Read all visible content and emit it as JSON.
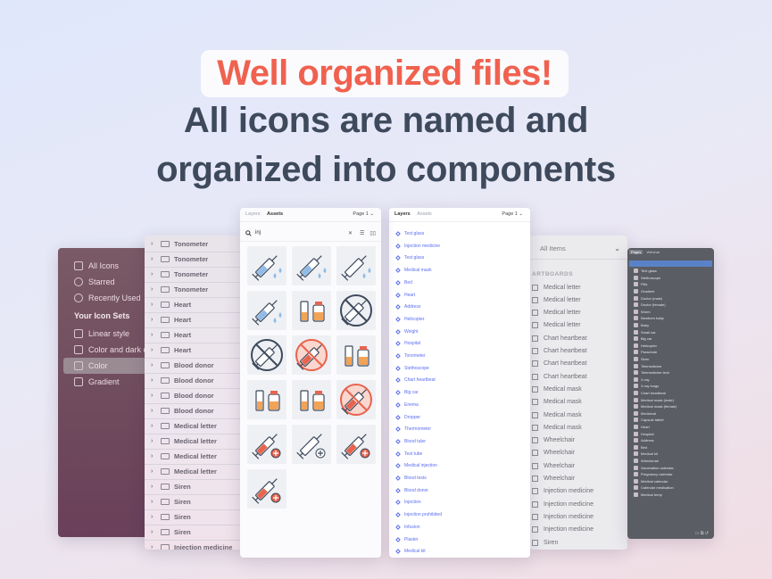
{
  "headline": {
    "title": "Well organized files!",
    "line1": "All icons are named and",
    "line2": "organized into components"
  },
  "colors": {
    "accent": "#f0614f",
    "headline_text": "#3e4a5c",
    "link_blue": "#5b6df0"
  },
  "sidebar": {
    "items": [
      "All Icons",
      "Starred",
      "Recently Used"
    ],
    "section_title": "Your Icon Sets",
    "sets": [
      "Linear style",
      "Color and dark o",
      "Color",
      "Gradient"
    ],
    "selected": "Color"
  },
  "layer_list_b": {
    "rows": [
      "Tonometer",
      "Tonometer",
      "Tonometer",
      "Tonometer",
      "Heart",
      "Heart",
      "Heart",
      "Heart",
      "Blood donor",
      "Blood donor",
      "Blood donor",
      "Blood donor",
      "Medical letter",
      "Medical letter",
      "Medical letter",
      "Medical letter",
      "Siren",
      "Siren",
      "Siren",
      "Siren",
      "Injection medicine"
    ]
  },
  "assets_panel": {
    "tab_layers": "Layers",
    "tab_assets": "Assets",
    "page": "Page 1",
    "search_value": "inj"
  },
  "layers_panel_d": {
    "tab_layers": "Layers",
    "tab_assets": "Assets",
    "page": "Page 1",
    "rows": [
      "Test glass",
      "Injection medicine",
      "Test glass",
      "Medical mask",
      "Bed",
      "Heart",
      "Address",
      "Helicopter",
      "Weight",
      "Hospital",
      "Tonometer",
      "Stethoscope",
      "Chart heartbeat",
      "Big car",
      "Enema",
      "Dropper",
      "Thermometer",
      "Blood tube",
      "Test tube",
      "Medical injection",
      "Blood tests",
      "Blood donor",
      "Injection",
      "Injection prohibited",
      "Infusion",
      "Plaster",
      "Medical kit"
    ]
  },
  "artboards_panel": {
    "search_placeholder": "All Items",
    "section": "ARTBOARDS",
    "rows": [
      "Medical letter",
      "Medical letter",
      "Medical letter",
      "Medical letter",
      "Chart heartbeat",
      "Chart heartbeat",
      "Chart heartbeat",
      "Chart heartbeat",
      "Medical mask",
      "Medical mask",
      "Medical mask",
      "Medical mask",
      "Wheelchair",
      "Wheelchair",
      "Wheelchair",
      "Wheelchair",
      "Injection medicine",
      "Injection medicine",
      "Injection medicine",
      "Injection medicine",
      "Siren"
    ]
  },
  "layers_panel_f": {
    "tab_a": "Pages",
    "tab_b": "Webinar",
    "rows": [
      "Text glass",
      "Stethoscope",
      "Pills",
      "Gradient",
      "Doctor (male)",
      "Doctor (female)",
      "Worm",
      "Newborn baby",
      "Baby",
      "Small car",
      "Big car",
      "Helicopter",
      "Parachute",
      "Siren",
      "Telemedicine",
      "Telemedicine tech",
      "X-ray",
      "X-ray lungs",
      "Chart heartbeat",
      "Medical mask (male)",
      "Medical mask (female)",
      "Medicinal",
      "Capsule tablet",
      "Heart",
      "Hospital",
      "Address",
      "Bed",
      "Medical kit",
      "Wheelchair",
      "Vaccination calendar",
      "Pregnancy calendar",
      "Medical calendar",
      "Calendar medication",
      "Medical temp"
    ]
  }
}
